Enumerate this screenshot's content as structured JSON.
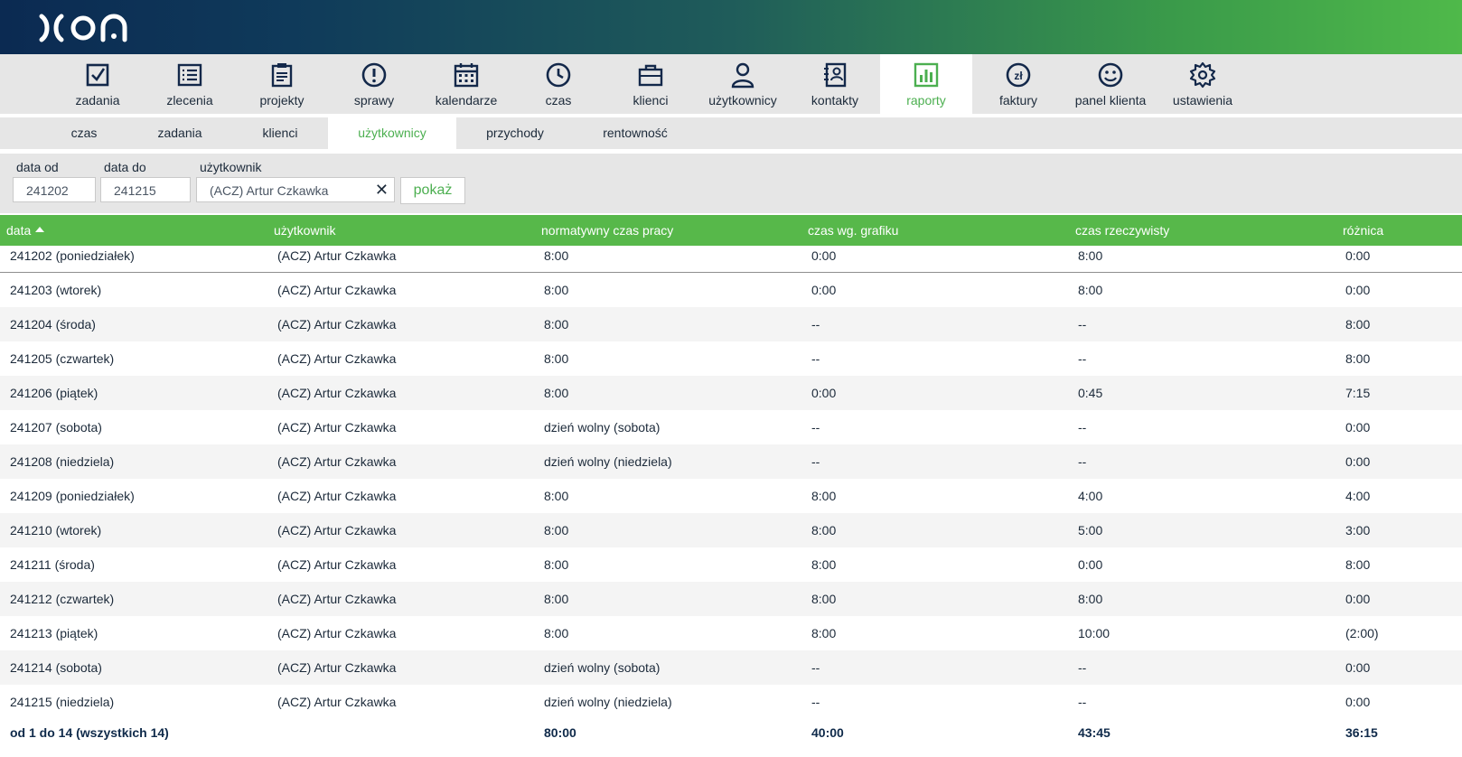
{
  "nav": {
    "items": [
      {
        "key": "zadania",
        "label": "zadania",
        "icon": "checkbox-icon"
      },
      {
        "key": "zlecenia",
        "label": "zlecenia",
        "icon": "list-icon"
      },
      {
        "key": "projekty",
        "label": "projekty",
        "icon": "clipboard-icon"
      },
      {
        "key": "sprawy",
        "label": "sprawy",
        "icon": "alert-circle-icon"
      },
      {
        "key": "kalendarze",
        "label": "kalendarze",
        "icon": "calendar-icon"
      },
      {
        "key": "czas",
        "label": "czas",
        "icon": "clock-icon"
      },
      {
        "key": "klienci",
        "label": "klienci",
        "icon": "briefcase-icon"
      },
      {
        "key": "uzytkownicy",
        "label": "użytkownicy",
        "icon": "user-icon"
      },
      {
        "key": "kontakty",
        "label": "kontakty",
        "icon": "contact-book-icon"
      },
      {
        "key": "raporty",
        "label": "raporty",
        "icon": "bar-chart-icon",
        "active": true
      },
      {
        "key": "faktury",
        "label": "faktury",
        "icon": "zloty-coin-icon"
      },
      {
        "key": "panel",
        "label": "panel klienta",
        "icon": "smiley-icon"
      },
      {
        "key": "ustawienia",
        "label": "ustawienia",
        "icon": "gear-icon"
      }
    ]
  },
  "subnav": {
    "tabs": [
      {
        "label": "czas"
      },
      {
        "label": "zadania"
      },
      {
        "label": "klienci"
      },
      {
        "label": "użytkownicy",
        "active": true
      },
      {
        "label": "przychody"
      },
      {
        "label": "rentowność"
      }
    ]
  },
  "filters": {
    "date_from_label": "data od",
    "date_from_value": "241202",
    "date_to_label": "data do",
    "date_to_value": "241215",
    "user_label": "użytkownik",
    "user_value": "(ACZ) Artur Czkawka",
    "clear_glyph": "✕",
    "show_label": "pokaż"
  },
  "table": {
    "headers": [
      "data",
      "użytkownik",
      "normatywny czas pracy",
      "czas wg. grafiku",
      "czas rzeczywisty",
      "różnica"
    ],
    "rows": [
      [
        "241202 (poniedziałek)",
        "(ACZ) Artur Czkawka",
        "8:00",
        "0:00",
        "8:00",
        "0:00"
      ],
      [
        "241203 (wtorek)",
        "(ACZ) Artur Czkawka",
        "8:00",
        "0:00",
        "8:00",
        "0:00"
      ],
      [
        "241204 (środa)",
        "(ACZ) Artur Czkawka",
        "8:00",
        "--",
        "--",
        "8:00"
      ],
      [
        "241205 (czwartek)",
        "(ACZ) Artur Czkawka",
        "8:00",
        "--",
        "--",
        "8:00"
      ],
      [
        "241206 (piątek)",
        "(ACZ) Artur Czkawka",
        "8:00",
        "0:00",
        "0:45",
        "7:15"
      ],
      [
        "241207 (sobota)",
        "(ACZ) Artur Czkawka",
        "dzień wolny (sobota)",
        "--",
        "--",
        "0:00"
      ],
      [
        "241208 (niedziela)",
        "(ACZ) Artur Czkawka",
        "dzień wolny (niedziela)",
        "--",
        "--",
        "0:00"
      ],
      [
        "241209 (poniedziałek)",
        "(ACZ) Artur Czkawka",
        "8:00",
        "8:00",
        "4:00",
        "4:00"
      ],
      [
        "241210 (wtorek)",
        "(ACZ) Artur Czkawka",
        "8:00",
        "8:00",
        "5:00",
        "3:00"
      ],
      [
        "241211 (środa)",
        "(ACZ) Artur Czkawka",
        "8:00",
        "8:00",
        "0:00",
        "8:00"
      ],
      [
        "241212 (czwartek)",
        "(ACZ) Artur Czkawka",
        "8:00",
        "8:00",
        "8:00",
        "0:00"
      ],
      [
        "241213 (piątek)",
        "(ACZ) Artur Czkawka",
        "8:00",
        "8:00",
        "10:00",
        "(2:00)"
      ],
      [
        "241214 (sobota)",
        "(ACZ) Artur Czkawka",
        "dzień wolny (sobota)",
        "--",
        "--",
        "0:00"
      ],
      [
        "241215 (niedziela)",
        "(ACZ) Artur Czkawka",
        "dzień wolny (niedziela)",
        "--",
        "--",
        "0:00"
      ]
    ],
    "footer": [
      "od 1 do 14 (wszystkich 14)",
      "",
      "80:00",
      "40:00",
      "43:45",
      "36:15"
    ]
  },
  "colors": {
    "accent_green": "#4caf50",
    "header_green": "#57b84a",
    "navy": "#0b2a52"
  }
}
